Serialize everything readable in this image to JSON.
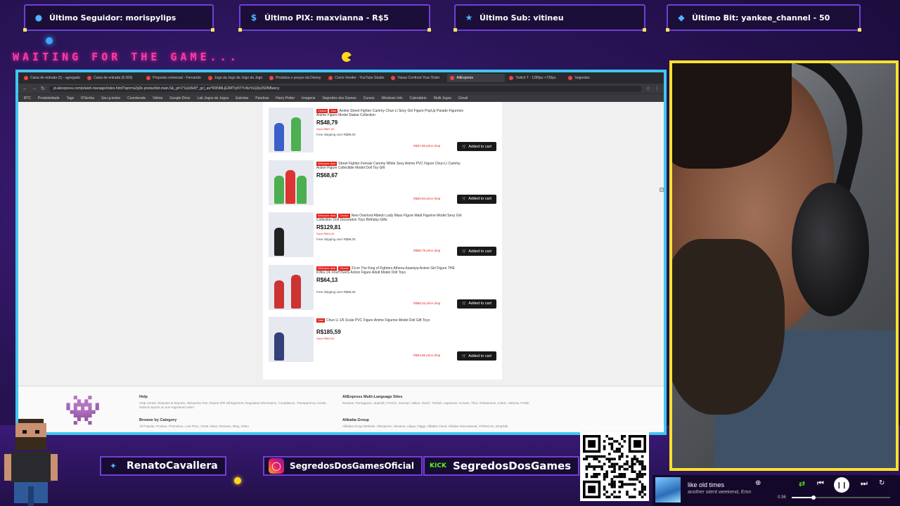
{
  "overlay": {
    "alerts": [
      {
        "label": "Último Seguidor: morispylips",
        "icon": "user-icon"
      },
      {
        "label": "Último PIX: maxvianna - R$5",
        "icon": "dollar-icon"
      },
      {
        "label": "Último Sub: vitineu",
        "icon": "star-icon"
      },
      {
        "label": "Último Bit: yankee_channel - 50",
        "icon": "diamond-icon"
      }
    ],
    "waiting_text": "WAITING FOR THE GAME...",
    "socials": [
      {
        "label": "RenatoCavallera",
        "icon": "twitter-icon"
      },
      {
        "label": "SegredosDosGamesOficial",
        "icon": "instagram-icon"
      },
      {
        "label": "SegredosDosGames",
        "icon": "kick-icon"
      }
    ],
    "qr_url": "livepix.gg/segredosdosgames",
    "accent_colors": {
      "frame": "#3ec7f0",
      "webcam_border": "#ffe12a",
      "neon_pink": "#ff3aa8",
      "alert_border": "#6f3fd6"
    }
  },
  "browser": {
    "tabs": [
      "Caixa de entrada (1) - agregado",
      "Caixa de entrada (8.369)",
      "Proposta comercial - Fernando",
      "Jogo da Jogo de Jogo da Jogo",
      "Produtos e preços da Disney",
      "Como Vender - YouTube Studio",
      "Yasuo Confront Your Order",
      "AliExpress",
      "Twitch T - 1280px ×720px",
      "Segredos"
    ],
    "active_tab": 7,
    "url": "pt.aliexpress.com/p/wish-manage/index.html?spm=a2g0o.productlist.main.5&_gl=1*1q1t6d0*_gcl_aw*R0NMLjE3MTIyNTYxNzYuQ2p3S0NBancy",
    "bookmarks": [
      "BTC",
      "Produtividade",
      "Tags",
      "IFSenha",
      "Seu g-todos",
      "Coordenate",
      "Vitória",
      "Google Drive",
      "Lab Jogos de Jogos",
      "Estrelas",
      "Pandora",
      "Harry Potter",
      "Imagens",
      "Segredos dos Games",
      "Cursos",
      "Windows Info",
      "Calendário",
      "Multi Jogos",
      "Gmail"
    ]
  },
  "results": [
    {
      "badges": [
        "Choice",
        "Sale"
      ],
      "title": "Anime Street Fighter Cammy Chun Li Sexy Girl Figure PopUp Parade Figurines Anime Figure Model Statue Collection",
      "price": "R$48,79",
      "old_price": "Save R$67,30",
      "shipping": "Free shipping over R$99,00",
      "drop": "R$37,85 price drop",
      "cart": "Added to cart",
      "figs": [
        "#3b5fc9",
        "#4caf50"
      ]
    },
    {
      "badges": [
        "Welcome deal"
      ],
      "title": "Street Fighter Female Cammy White Sexy Anime PVC Figure Chun Li Cammy Action Figure Collectible Model Doll Toy Gift",
      "price": "R$68,67",
      "old_price": "",
      "shipping": "",
      "drop": "R$26,94 price drop",
      "cart": "Added to cart",
      "figs": [
        "#4caf50",
        "#d33",
        "#4caf50"
      ]
    },
    {
      "badges": [
        "Welcome deal",
        "Choice"
      ],
      "title": "New Overlord Albedo Lady Mass Figure Maid Figurine Model Sexy Girl Collection Doll Decoration Toys Birthday Gifts",
      "price": "R$129,81",
      "old_price": "Save R$44,00",
      "shipping": "Free shipping over R$99,00",
      "drop": "R$58,79 price drop",
      "cart": "Added to cart",
      "figs": [
        "#222"
      ]
    },
    {
      "badges": [
        "Welcome deal",
        "Choice"
      ],
      "title": "21cm The King of Fighters Athena Asamiya Anime Girl Figure THE KING OF FIGHTERS Action Figure Adult Model Doll Toys",
      "price": "R$64,13",
      "old_price": "",
      "shipping": "Free shipping over R$99,00",
      "drop": "R$66,02 price drop",
      "cart": "Added to cart",
      "figs": [
        "#c33",
        "#c33"
      ]
    },
    {
      "badges": [
        "Sale"
      ],
      "title": "Chun Li 1/6 Scale PVC Figure Anime Figurine Model Doll Gift Toys",
      "price": "R$185,59",
      "old_price": "Save R$40,00",
      "shipping": "",
      "drop": "R$24,96 price drop",
      "cart": "Added to cart",
      "figs": [
        "#33407a"
      ]
    }
  ],
  "footer": {
    "help_title": "Help",
    "help_text": "Help Center, Disputes & Reports, AliExpress Fee, Report IPR infringement, Regulated Information, Compliance, Transparency Center, Submit reports on non-registered users",
    "browse_title": "Browse by Category",
    "browse_text": "All Popular, Product, Promotion, Low Price, Great Value, Reviews, Blog, Video",
    "multi_title": "AliExpress Multi-Language Sites",
    "multi_text": "Russian, Portuguese, Spanish, French, German, Italian, Dutch, Turkish, Japanese, Korean, Thai, Vietnamese, Arabic, Hebrew, Polish",
    "group_title": "Alibaba Group",
    "group_text": "Alibaba Group Website, AliExpress, Alimama, Alipay, Fliggy, Alibaba Cloud, Alibaba International, AliTelecom, DingTalk"
  },
  "music": {
    "title": "like old times",
    "artist": "another silent weekend, Emmit Fenn",
    "time": "0:36",
    "progress": 0.22
  }
}
